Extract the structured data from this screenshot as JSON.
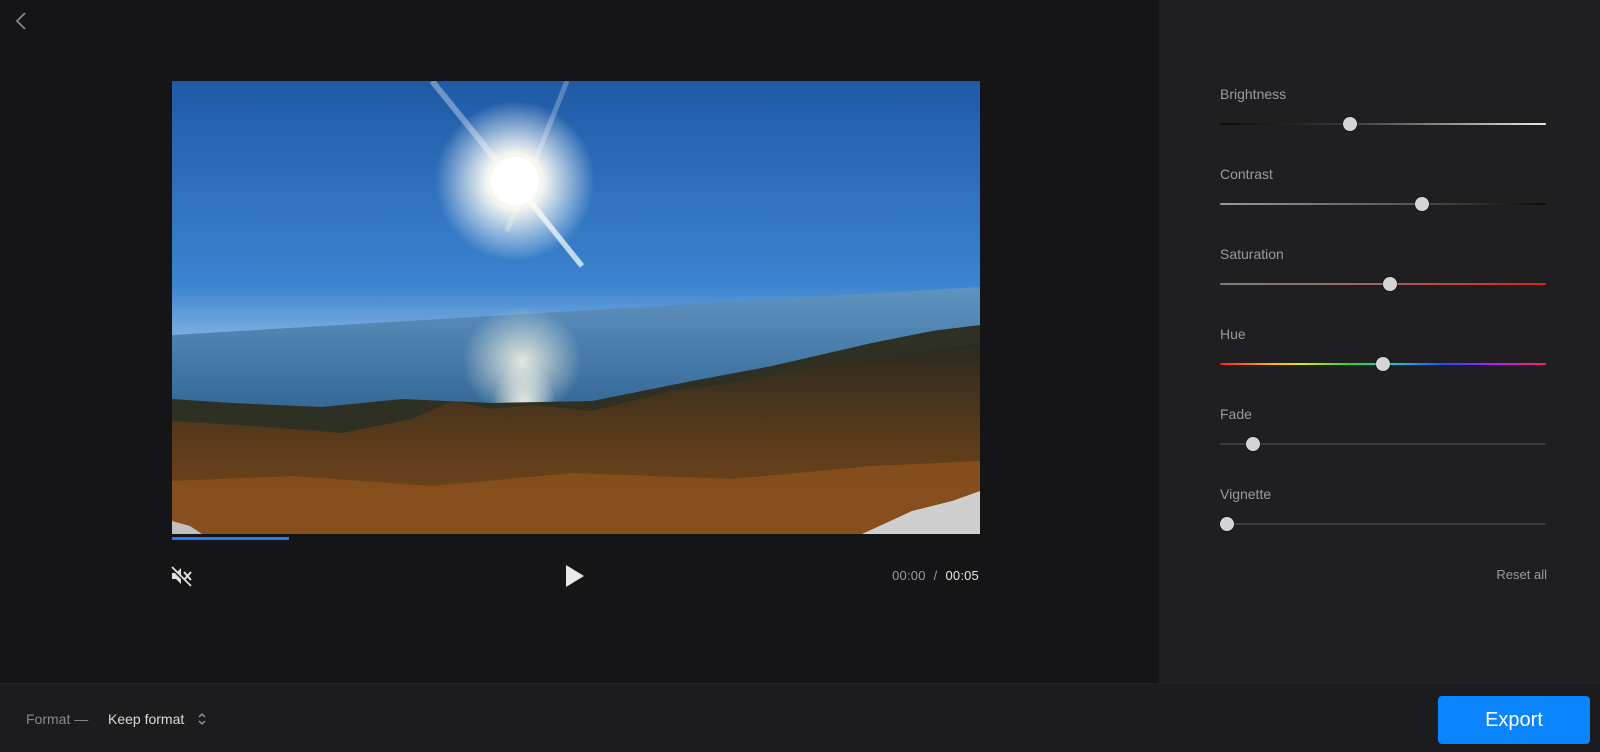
{
  "player": {
    "progress_fraction": 0.145,
    "current_time": "00:00",
    "separator": "/",
    "total_time": "00:05",
    "mute_icon": "speaker-muted-icon",
    "play_icon": "play-icon",
    "back_icon": "chevron-left-icon"
  },
  "adjustments": [
    {
      "key": "brightness",
      "label": "Brightness",
      "value": 0.4
    },
    {
      "key": "contrast",
      "label": "Contrast",
      "value": 0.62
    },
    {
      "key": "saturation",
      "label": "Saturation",
      "value": 0.52
    },
    {
      "key": "hue",
      "label": "Hue",
      "value": 0.5
    },
    {
      "key": "fade",
      "label": "Fade",
      "value": 0.1
    },
    {
      "key": "vignette",
      "label": "Vignette",
      "value": 0.02
    }
  ],
  "panel": {
    "reset_label": "Reset all"
  },
  "bottombar": {
    "format_label": "Format —",
    "format_value": "Keep format",
    "export_label": "Export"
  },
  "colors": {
    "accent": "#0a84ff",
    "progress": "#1e7bf2",
    "panel_bg": "#1f1f21",
    "editor_bg": "#151517"
  }
}
